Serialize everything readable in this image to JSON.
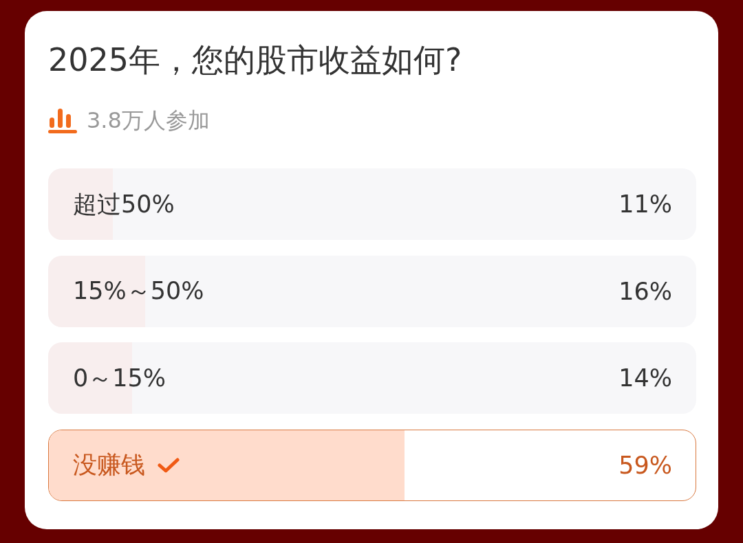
{
  "poll": {
    "title": "2025年，您的股市收益如何?",
    "participants": "3.8万人参加",
    "options": [
      {
        "label": "超过50%",
        "percent": "11%",
        "level": 0.1,
        "selected": false
      },
      {
        "label": "15%～50%",
        "percent": "16%",
        "level": 0.15,
        "selected": false
      },
      {
        "label": "0～15%",
        "percent": "14%",
        "level": 0.13,
        "selected": false
      },
      {
        "label": "没赚钱",
        "percent": "59%",
        "level": 0.55,
        "selected": true
      }
    ]
  }
}
